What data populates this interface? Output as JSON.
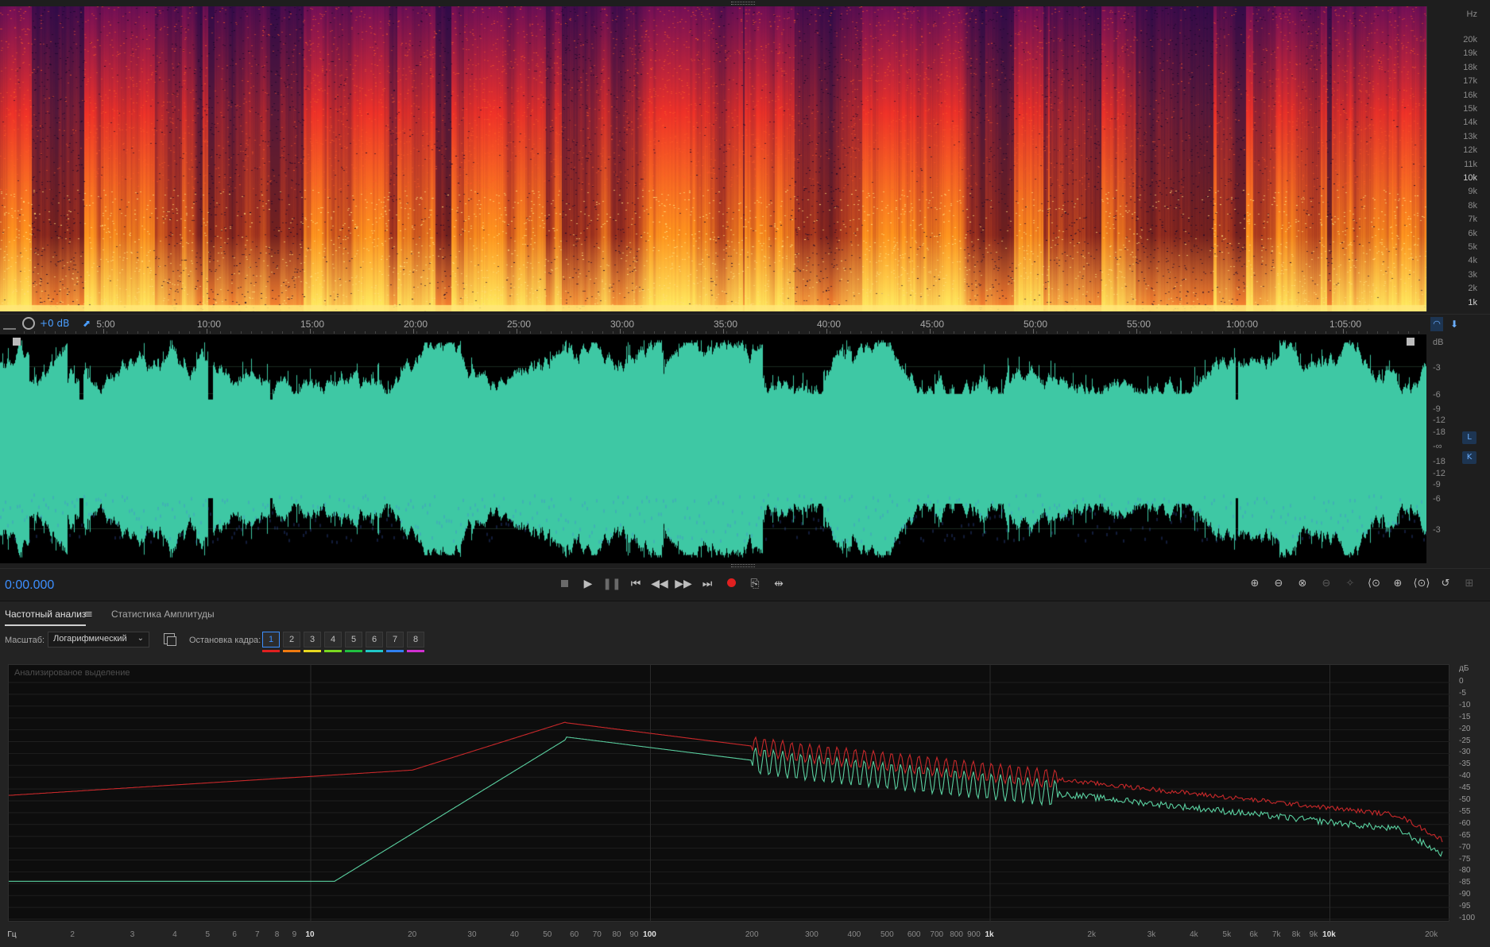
{
  "spectrogram": {
    "unit_label": "Hz",
    "freq_labels": [
      "20k",
      "19k",
      "18k",
      "17k",
      "16k",
      "15k",
      "14k",
      "13k",
      "12k",
      "11k",
      "10k",
      "9k",
      "8k",
      "7k",
      "6k",
      "5k",
      "4k",
      "3k",
      "2k",
      "1k"
    ]
  },
  "timeline": {
    "gain_label": "+0 dB",
    "labels": [
      "5:00",
      "10:00",
      "15:00",
      "20:00",
      "25:00",
      "30:00",
      "35:00",
      "40:00",
      "45:00",
      "50:00",
      "55:00",
      "1:00:00",
      "1:05:00"
    ]
  },
  "waveform": {
    "unit_label": "dB",
    "db_labels": [
      "-3",
      "-6",
      "-9",
      "-12",
      "-18",
      "-∞",
      "-18",
      "-12",
      "-9",
      "-6",
      "-3"
    ],
    "channel_left": "L",
    "channel_right": "K",
    "fill_color": "#3ec8a4"
  },
  "transport": {
    "time": "0:00.000",
    "record_color": "#e02020"
  },
  "panel": {
    "tab_freq": "Частотный анализ",
    "tab_menu_icon": "≡",
    "tab_amp": "Статистика Амплитуды",
    "scale_label": "Масштаб:",
    "scale_value": "Логарифмический",
    "freeze_label": "Остановка кадра:",
    "freeze_buttons": [
      "1",
      "2",
      "3",
      "4",
      "5",
      "6",
      "7",
      "8"
    ],
    "freeze_colors": [
      "#e02020",
      "#f07a10",
      "#e8d820",
      "#7ad820",
      "#20c040",
      "#20c8c8",
      "#3080f0",
      "#d030d0"
    ],
    "graph_caption": "Анализированое выделение"
  },
  "freq_graph": {
    "y_unit": "дБ",
    "y_labels": [
      "0",
      "-5",
      "-10",
      "-15",
      "-20",
      "-25",
      "-30",
      "-35",
      "-40",
      "-45",
      "-50",
      "-55",
      "-60",
      "-65",
      "-70",
      "-75",
      "-80",
      "-85",
      "-90",
      "-95",
      "-100"
    ],
    "x_unit": "Гц",
    "x_ticks": [
      {
        "f": 2,
        "label": "2"
      },
      {
        "f": 3,
        "label": "3"
      },
      {
        "f": 4,
        "label": "4"
      },
      {
        "f": 5,
        "label": "5"
      },
      {
        "f": 6,
        "label": "6"
      },
      {
        "f": 7,
        "label": "7"
      },
      {
        "f": 8,
        "label": "8"
      },
      {
        "f": 9,
        "label": "9"
      },
      {
        "f": 10,
        "label": "10"
      },
      {
        "f": 20,
        "label": "20"
      },
      {
        "f": 30,
        "label": "30"
      },
      {
        "f": 40,
        "label": "40"
      },
      {
        "f": 50,
        "label": "50"
      },
      {
        "f": 60,
        "label": "60"
      },
      {
        "f": 70,
        "label": "70"
      },
      {
        "f": 80,
        "label": "80"
      },
      {
        "f": 90,
        "label": "90"
      },
      {
        "f": 100,
        "label": "100"
      },
      {
        "f": 200,
        "label": "200"
      },
      {
        "f": 300,
        "label": "300"
      },
      {
        "f": 400,
        "label": "400"
      },
      {
        "f": 500,
        "label": "500"
      },
      {
        "f": 600,
        "label": "600"
      },
      {
        "f": 700,
        "label": "700"
      },
      {
        "f": 800,
        "label": "800"
      },
      {
        "f": 900,
        "label": "900"
      },
      {
        "f": 1000,
        "label": "1k"
      },
      {
        "f": 2000,
        "label": "2k"
      },
      {
        "f": 3000,
        "label": "3k"
      },
      {
        "f": 4000,
        "label": "4k"
      },
      {
        "f": 5000,
        "label": "5k"
      },
      {
        "f": 6000,
        "label": "6k"
      },
      {
        "f": 7000,
        "label": "7k"
      },
      {
        "f": 8000,
        "label": "8k"
      },
      {
        "f": 9000,
        "label": "9k"
      },
      {
        "f": 10000,
        "label": "10k"
      },
      {
        "f": 20000,
        "label": "20k"
      }
    ],
    "series_colors": [
      "#c8282a",
      "#5ad0a0"
    ]
  }
}
